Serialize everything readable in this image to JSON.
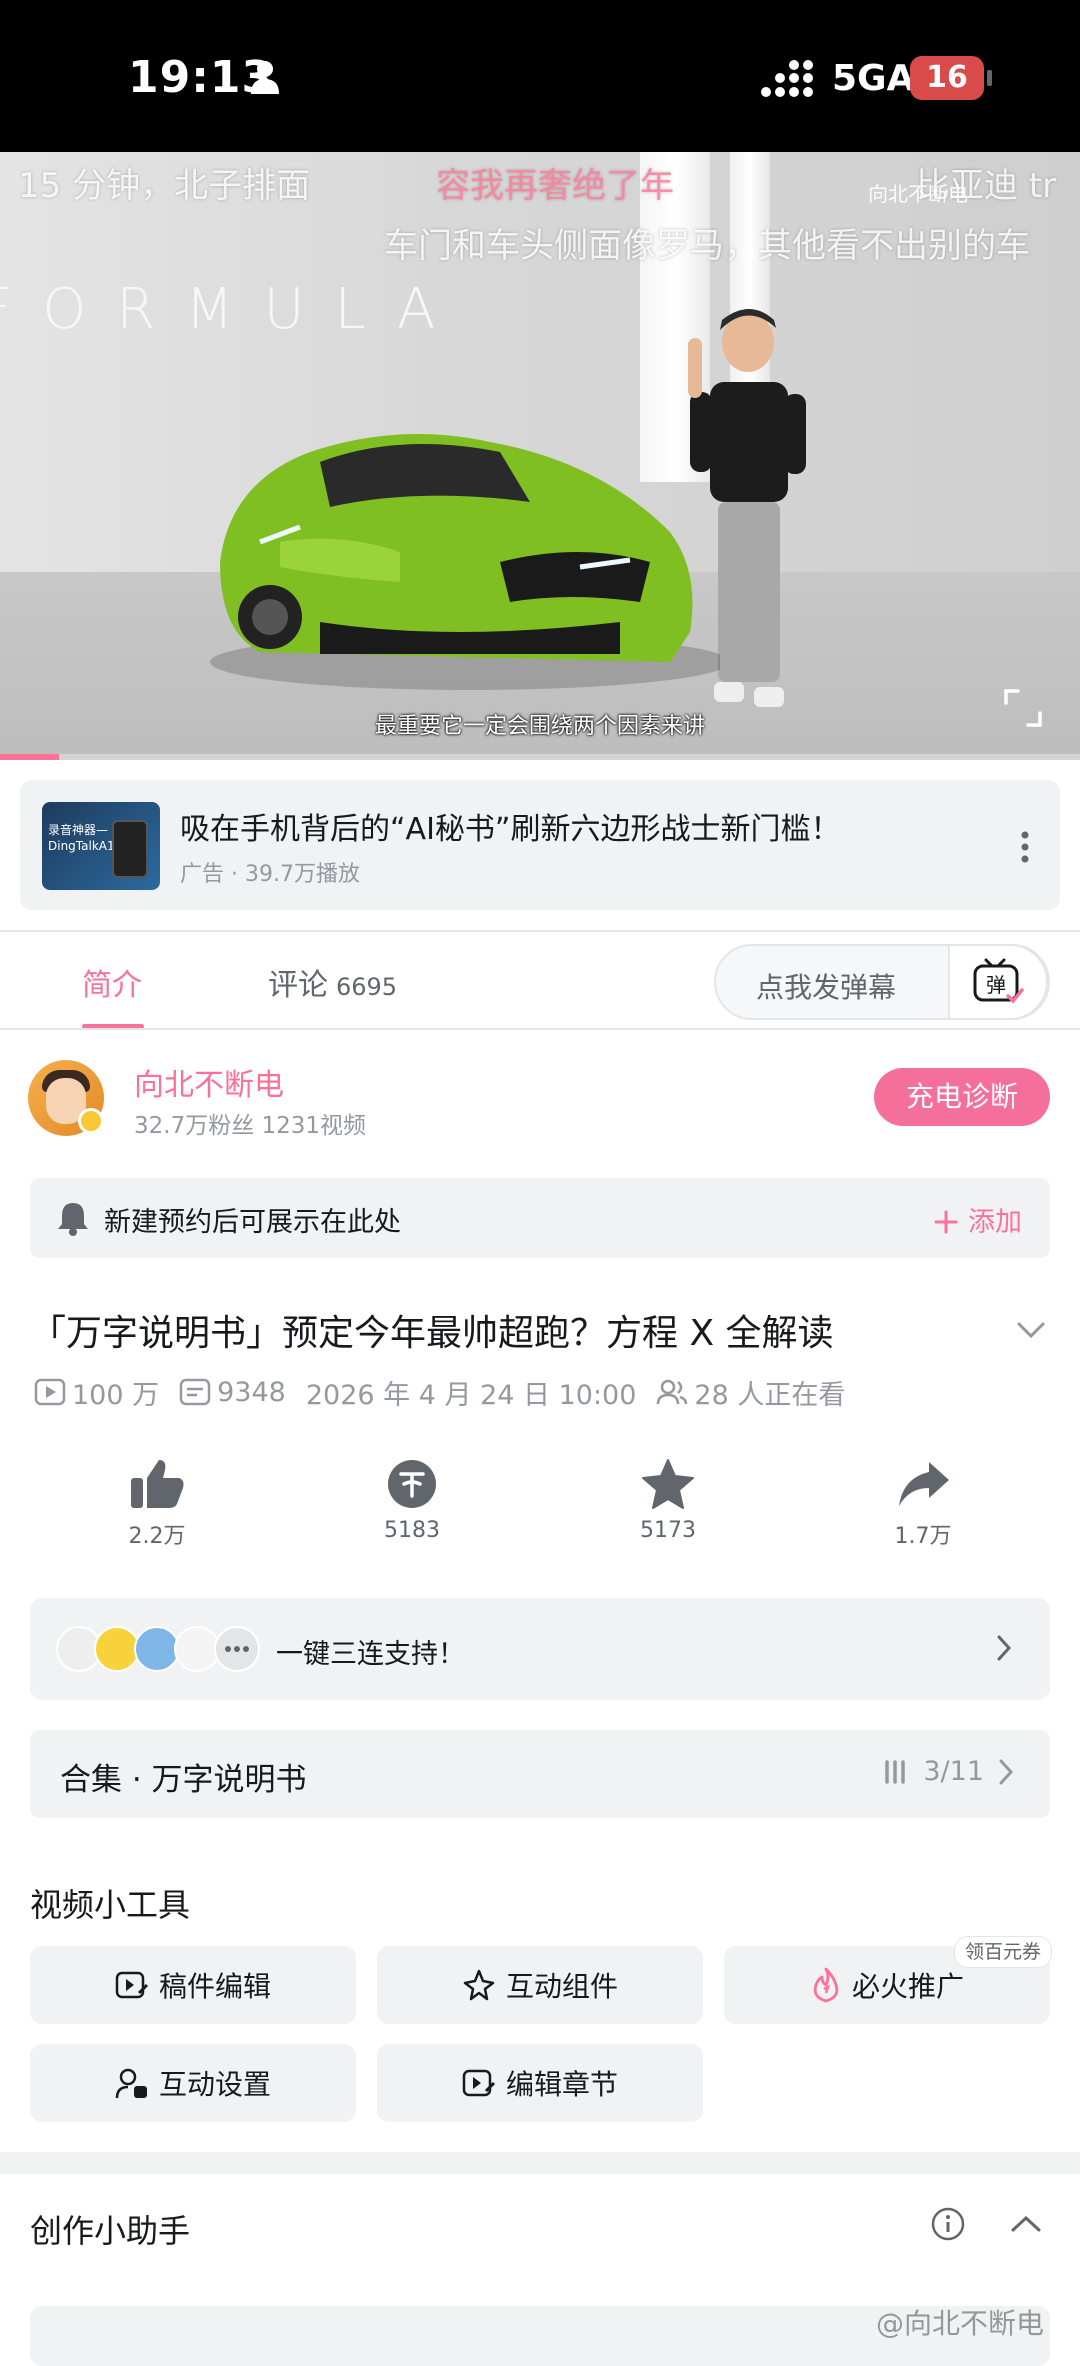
{
  "status_bar": {
    "time": "19:13",
    "network": "5GA",
    "battery": "16"
  },
  "video": {
    "danmaku": [
      "15 分钟，北子排面",
      "容我再奢绝了年",
      "比亚迪 tr",
      "车门和车头侧面像罗马，其他看不出别的车"
    ],
    "backdrop_text": "FORMULA",
    "watermark": "向北不断电",
    "subtitle": "最重要它一定会围绕两个因素来讲",
    "progress": 0.055
  },
  "ad": {
    "thumb_text": "录音神器—DingTalkA1",
    "title": "吸在手机背后的“AI秘书”刷新六边形战士新门槛！",
    "subtitle": "广告 · 39.7万播放"
  },
  "tabs": {
    "intro": "简介",
    "comment": "评论",
    "comment_count": "6695",
    "danmaku_placeholder": "点我发弹幕",
    "danmaku_toggle": "弹"
  },
  "uploader": {
    "name": "向北不断电",
    "stats": "32.7万粉丝  1231视频",
    "charge_button": "充电诊断"
  },
  "reservation": {
    "text": "新建预约后可展示在此处",
    "add": "添加"
  },
  "video_info": {
    "title": "「万字说明书」预定今年最帅超跑？方程 X 全解读",
    "views": "100 万",
    "danmaku_count": "9348",
    "date": "2026 年 4 月 24 日 10:00",
    "watching": "28 人正在看"
  },
  "actions": {
    "like": "2.2万",
    "coin": "5183",
    "favorite": "5173",
    "share": "1.7万"
  },
  "triple": {
    "text": "一键三连支持！"
  },
  "collection": {
    "title": "合集 · 万字说明书",
    "progress": "3/11"
  },
  "tools": {
    "heading": "视频小工具",
    "items": [
      "稿件编辑",
      "互动组件",
      "必火推广",
      "互动设置",
      "编辑章节"
    ],
    "badge": "领百元券"
  },
  "assistant": {
    "heading": "创作小助手"
  },
  "footer_watermark": "@向北不断电",
  "colors": {
    "accent": "#fb7299",
    "muted": "#9499a0",
    "card_bg": "#f1f2f3"
  }
}
